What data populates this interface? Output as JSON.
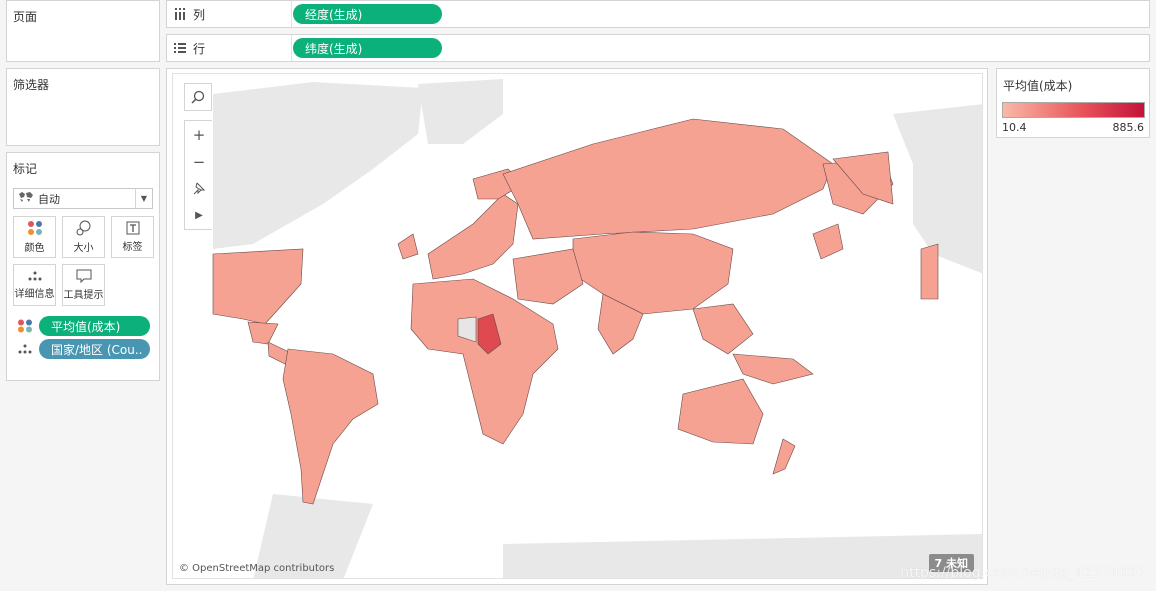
{
  "pages_card": {
    "title": "页面"
  },
  "filters_card": {
    "title": "筛选器"
  },
  "columns_shelf": {
    "label": "列",
    "pill": "经度(生成)"
  },
  "rows_shelf": {
    "label": "行",
    "pill": "纬度(生成)"
  },
  "marks_card": {
    "title": "标记",
    "mark_type": "自动",
    "buttons": [
      {
        "label": "颜色",
        "icon": "color-dots-icon"
      },
      {
        "label": "大小",
        "icon": "size-circles-icon"
      },
      {
        "label": "标签",
        "icon": "label-T-icon"
      },
      {
        "label": "详细信息",
        "icon": "detail-dots-icon"
      },
      {
        "label": "工具提示",
        "icon": "tooltip-speech-icon"
      }
    ],
    "fields": [
      {
        "label": "平均值(成本)",
        "type": "color"
      },
      {
        "label": "国家/地区 (Cou..",
        "type": "detail"
      }
    ]
  },
  "legend": {
    "title": "平均值(成本)",
    "min": "10.4",
    "max": "885.6",
    "colors": {
      "low": "#fbb9a8",
      "mid": "#e9555a",
      "high": "#c2123b"
    }
  },
  "map": {
    "attribution": "© OpenStreetMap contributors",
    "unknown_badge": "7 未知",
    "land_color": "#f6a293",
    "land_base": "#e8e8e8",
    "dark_region": "#de4a4f"
  },
  "watermark": "https://blog.csdn.net/qq_42374697"
}
